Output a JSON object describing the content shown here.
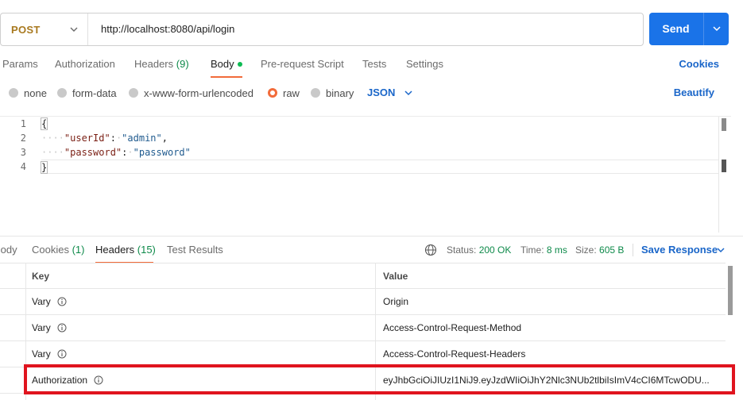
{
  "request": {
    "method": "POST",
    "url": "http://localhost:8080/api/login",
    "send_label": "Send"
  },
  "request_tabs": {
    "items": [
      {
        "label": "Params"
      },
      {
        "label": "Authorization"
      },
      {
        "label": "Headers",
        "count": "(9)"
      },
      {
        "label": "Body"
      },
      {
        "label": "Pre-request Script"
      },
      {
        "label": "Tests"
      },
      {
        "label": "Settings"
      }
    ],
    "active": "Body",
    "cookies_label": "Cookies"
  },
  "body_modes": {
    "items": [
      "none",
      "form-data",
      "x-www-form-urlencoded",
      "raw",
      "binary"
    ],
    "selected": "raw",
    "format": "JSON",
    "beautify_label": "Beautify"
  },
  "editor": {
    "line_numbers": [
      "1",
      "2",
      "3",
      "4"
    ],
    "open_brace": "{",
    "close_brace": "}",
    "key1": "\"userId\"",
    "val1": "\"admin\"",
    "key2": "\"password\"",
    "val2": "\"password\"",
    "colon": ":",
    "comma": ","
  },
  "response_tabs": {
    "body": "Body",
    "cookies": "Cookies",
    "cookies_count": "(1)",
    "headers": "Headers",
    "headers_count": "(15)",
    "test_results": "Test Results",
    "active": "Headers"
  },
  "status": {
    "status_label": "Status:",
    "status_value": "200 OK",
    "time_label": "Time:",
    "time_value": "8 ms",
    "size_label": "Size:",
    "size_value": "605 B",
    "save_response_label": "Save Response"
  },
  "headers_table": {
    "columns": [
      "Key",
      "Value"
    ],
    "rows": [
      {
        "key": "Vary",
        "value": "Origin"
      },
      {
        "key": "Vary",
        "value": "Access-Control-Request-Method"
      },
      {
        "key": "Vary",
        "value": "Access-Control-Request-Headers"
      },
      {
        "key": "Authorization",
        "value": "eyJhbGciOiJIUzI1NiJ9.eyJzdWIiOiJhY2Nlc3NUb2tlbiIsImV4cCI6MTcwODU..."
      }
    ]
  },
  "colors": {
    "send": "#1a73e8",
    "accent_orange": "#f26b3a",
    "link_blue": "#1a66c9",
    "status_green": "#0e8a4a",
    "highlight_red": "#e0141e",
    "method_post": "#a8791f"
  }
}
